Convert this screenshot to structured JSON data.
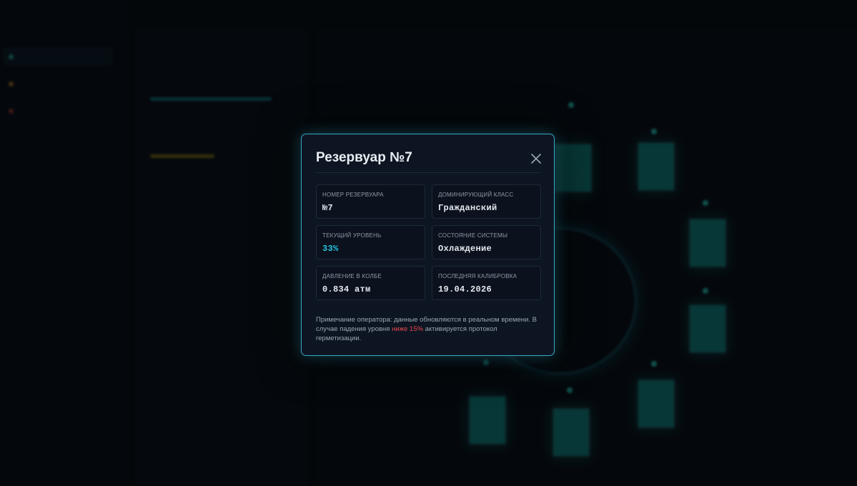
{
  "modal": {
    "title": "Резервуар №7",
    "fields": [
      {
        "label": "Номер резервуара",
        "value": "№7"
      },
      {
        "label": "Доминирующий класс",
        "value": "Гражданский"
      },
      {
        "label": "Текущий уровень",
        "value": "33%"
      },
      {
        "label": "Состояние системы",
        "value": "Охлаждение"
      },
      {
        "label": "Давление в колбе",
        "value": "0.834 атм"
      },
      {
        "label": "Последняя калибровка",
        "value": "19.04.2026"
      }
    ],
    "note_before": "Примечание оператора: данные обновляются в реальном времени. В случае падения уровня ",
    "note_warn": "ниже 15%",
    "note_after": " активируется протокол герметизации."
  },
  "colors": {
    "accent": "#22c3df",
    "border": "#38a8c4",
    "warning": "#e5484d",
    "tank": "#0f8f86"
  }
}
